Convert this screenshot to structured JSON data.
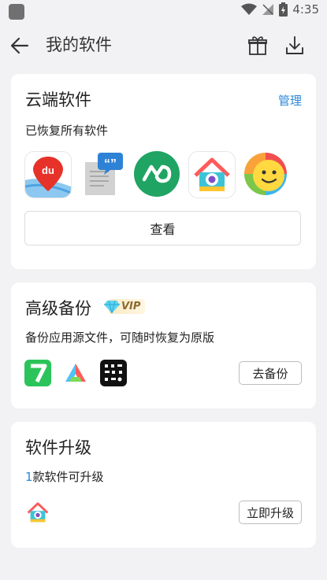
{
  "status_bar": {
    "time": "4:35"
  },
  "header": {
    "title": "我的软件"
  },
  "cloud": {
    "title": "云端软件",
    "manage_label": "管理",
    "subtitle": "已恢复所有软件",
    "view_label": "查看",
    "apps": [
      {
        "icon": "baidu-map-icon"
      },
      {
        "icon": "quote-doc-icon"
      },
      {
        "icon": "green-infinity-icon"
      },
      {
        "icon": "house-camera-icon"
      },
      {
        "icon": "smiley-browser-icon"
      }
    ]
  },
  "backup": {
    "title": "高级备份",
    "vip_label": "VIP",
    "subtitle": "备份应用源文件，可随时恢复为原版",
    "button_label": "去备份",
    "apps": [
      {
        "icon": "green-seven-icon"
      },
      {
        "icon": "triangle-a-icon"
      },
      {
        "icon": "qr-grid-icon"
      }
    ]
  },
  "upgrade": {
    "title": "软件升级",
    "count": "1",
    "count_suffix": "款软件可升级",
    "button_label": "立即升级",
    "apps": [
      {
        "icon": "house-camera-icon"
      }
    ]
  },
  "colors": {
    "accent": "#2b88d8",
    "background": "#f2f2f4",
    "card": "#ffffff"
  }
}
